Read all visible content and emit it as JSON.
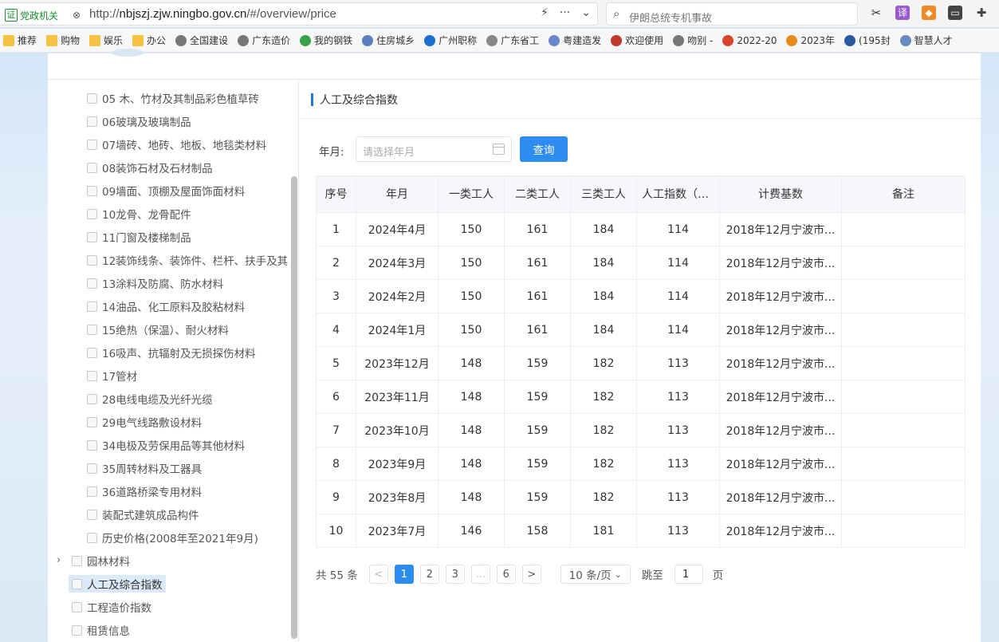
{
  "browser": {
    "site_badge_icon": "证",
    "site_badge_label": "党政机关",
    "url_prefix": "http://",
    "url_host": "nbjszj.zjw.ningbo.gov.cn",
    "url_path": "/#/overview/price",
    "search_placeholder": "伊朗总统专机事故"
  },
  "bookmarks": [
    {
      "label": "推荐",
      "icon": "folder"
    },
    {
      "label": "购物",
      "icon": "folder"
    },
    {
      "label": "娱乐",
      "icon": "folder"
    },
    {
      "label": "办公",
      "icon": "folder"
    },
    {
      "label": "全国建设",
      "icon": "site"
    },
    {
      "label": "广东造价",
      "icon": "site"
    },
    {
      "label": "我的钢铁",
      "icon": "site"
    },
    {
      "label": "住房城乡",
      "icon": "site"
    },
    {
      "label": "广州职称",
      "icon": "site"
    },
    {
      "label": "广东省工",
      "icon": "site"
    },
    {
      "label": "粤建造发",
      "icon": "site"
    },
    {
      "label": "欢迎使用",
      "icon": "site"
    },
    {
      "label": "吻别 -",
      "icon": "site"
    },
    {
      "label": "2022-20",
      "icon": "site"
    },
    {
      "label": "2023年",
      "icon": "site"
    },
    {
      "label": "(195封",
      "icon": "site"
    },
    {
      "label": "智慧人才",
      "icon": "site"
    }
  ],
  "sidebar": {
    "items": [
      {
        "label": "05 木、竹材及其制品彩色植草砖",
        "level": 2
      },
      {
        "label": "06玻璃及玻璃制品",
        "level": 2
      },
      {
        "label": "07墙砖、地砖、地板、地毯类材料",
        "level": 2
      },
      {
        "label": "08装饰石材及石材制品",
        "level": 2
      },
      {
        "label": "09墙面、顶棚及屋面饰面材料",
        "level": 2
      },
      {
        "label": "10龙骨、龙骨配件",
        "level": 2
      },
      {
        "label": "11门窗及楼梯制品",
        "level": 2
      },
      {
        "label": "12装饰线条、装饰件、栏杆、扶手及其",
        "level": 2
      },
      {
        "label": "13涂料及防腐、防水材料",
        "level": 2
      },
      {
        "label": "14油品、化工原料及胶粘材料",
        "level": 2
      },
      {
        "label": "15绝热（保温）、耐火材料",
        "level": 2
      },
      {
        "label": "16吸声、抗辐射及无损探伤材料",
        "level": 2
      },
      {
        "label": "17管材",
        "level": 2
      },
      {
        "label": "28电线电缆及光纤光缆",
        "level": 2
      },
      {
        "label": "29电气线路敷设材料",
        "level": 2
      },
      {
        "label": "34电极及劳保用品等其他材料",
        "level": 2
      },
      {
        "label": "35周转材料及工器具",
        "level": 2
      },
      {
        "label": "36道路桥梁专用材料",
        "level": 2
      },
      {
        "label": "装配式建筑成品构件",
        "level": 2
      },
      {
        "label": "历史价格(2008年至2021年9月)",
        "level": 2
      },
      {
        "label": "园林材料",
        "level": 1
      },
      {
        "label": "人工及综合指数",
        "level": 1
      },
      {
        "label": "工程造价指数",
        "level": 1
      },
      {
        "label": "租赁信息",
        "level": 1
      }
    ]
  },
  "main": {
    "section_title": "人工及综合指数",
    "filter_label": "年月:",
    "date_placeholder": "请选择年月",
    "query_label": "查询",
    "table": {
      "headers": [
        "序号",
        "年月",
        "一类工人",
        "二类工人",
        "三类工人",
        "人工指数（%）",
        "计费基数",
        "备注"
      ],
      "rows": [
        [
          "1",
          "2024年4月",
          "150",
          "161",
          "184",
          "114",
          "2018年12月宁波市...",
          ""
        ],
        [
          "2",
          "2024年3月",
          "150",
          "161",
          "184",
          "114",
          "2018年12月宁波市...",
          ""
        ],
        [
          "3",
          "2024年2月",
          "150",
          "161",
          "184",
          "114",
          "2018年12月宁波市...",
          ""
        ],
        [
          "4",
          "2024年1月",
          "150",
          "161",
          "184",
          "114",
          "2018年12月宁波市...",
          ""
        ],
        [
          "5",
          "2023年12月",
          "148",
          "159",
          "182",
          "113",
          "2018年12月宁波市...",
          ""
        ],
        [
          "6",
          "2023年11月",
          "148",
          "159",
          "182",
          "113",
          "2018年12月宁波市...",
          ""
        ],
        [
          "7",
          "2023年10月",
          "148",
          "159",
          "182",
          "113",
          "2018年12月宁波市...",
          ""
        ],
        [
          "8",
          "2023年9月",
          "148",
          "159",
          "182",
          "113",
          "2018年12月宁波市...",
          ""
        ],
        [
          "9",
          "2023年8月",
          "148",
          "159",
          "182",
          "113",
          "2018年12月宁波市...",
          ""
        ],
        [
          "10",
          "2023年7月",
          "146",
          "158",
          "181",
          "113",
          "2018年12月宁波市...",
          ""
        ]
      ]
    },
    "pager": {
      "total": "共 55 条",
      "prev": "<",
      "pages": [
        "1",
        "2",
        "3",
        "...",
        "6"
      ],
      "next": ">",
      "page_size": "10 条/页",
      "jump_label": "跳至",
      "jump_value": "1",
      "page_suffix": "页"
    }
  }
}
